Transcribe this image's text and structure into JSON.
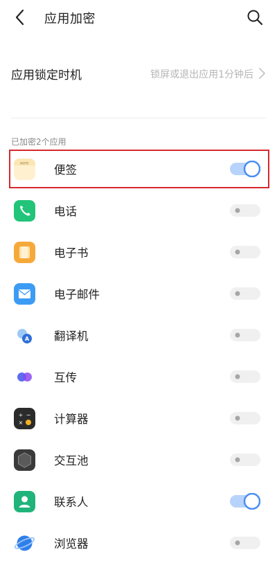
{
  "header": {
    "title": "应用加密",
    "back_icon": "chevron-left-icon",
    "search_icon": "search-icon"
  },
  "lock_timing": {
    "label": "应用锁定时机",
    "value": "锁屏或退出应用1分钟后"
  },
  "section_title": "已加密2个应用",
  "apps": [
    {
      "name": "便签",
      "icon": "notes-icon",
      "icon_text": "NOTE",
      "enabled": true
    },
    {
      "name": "电话",
      "icon": "phone-icon",
      "enabled": false
    },
    {
      "name": "电子书",
      "icon": "ebook-icon",
      "enabled": false
    },
    {
      "name": "电子邮件",
      "icon": "email-icon",
      "enabled": false
    },
    {
      "name": "翻译机",
      "icon": "translator-icon",
      "enabled": false
    },
    {
      "name": "互传",
      "icon": "share-icon",
      "enabled": false
    },
    {
      "name": "计算器",
      "icon": "calculator-icon",
      "enabled": false
    },
    {
      "name": "交互池",
      "icon": "hexagon-icon",
      "enabled": false
    },
    {
      "name": "联系人",
      "icon": "contacts-icon",
      "enabled": true
    },
    {
      "name": "浏览器",
      "icon": "browser-icon",
      "enabled": false
    }
  ],
  "colors": {
    "toggle_on_track": "#b8d3fb",
    "toggle_on_ring": "#4a8ef2",
    "toggle_off_track": "#f0f0f0",
    "toggle_off_knob": "#a6a6a6",
    "highlight": "#d6282d"
  }
}
